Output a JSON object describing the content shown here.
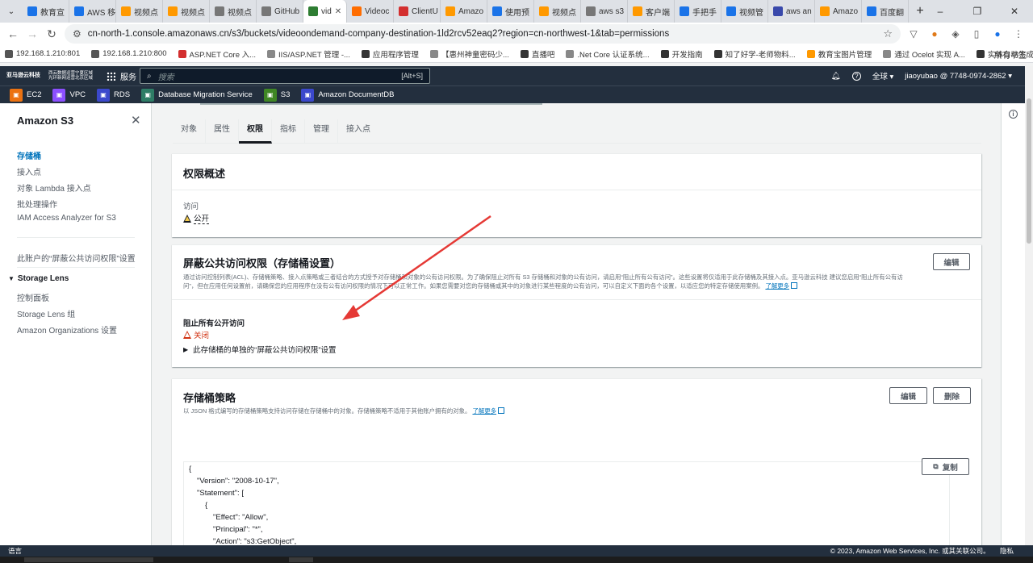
{
  "browser": {
    "tabs": [
      {
        "label": "教育宣",
        "color": "#1a73e8"
      },
      {
        "label": "AWS 移",
        "color": "#1a73e8"
      },
      {
        "label": "视频点",
        "color": "#ff9900"
      },
      {
        "label": "视频点",
        "color": "#ff9900"
      },
      {
        "label": "视频点",
        "color": "#777777"
      },
      {
        "label": "GitHub",
        "color": "#777777"
      },
      {
        "label": "vid",
        "color": "#2e7d32",
        "active": true
      },
      {
        "label": "Videoc",
        "color": "#ff6d00"
      },
      {
        "label": "ClientU",
        "color": "#d32f2f"
      },
      {
        "label": "Amazo",
        "color": "#ff9900"
      },
      {
        "label": "使用预",
        "color": "#1a73e8"
      },
      {
        "label": "视频点",
        "color": "#ff9900"
      },
      {
        "label": "aws s3",
        "color": "#777777"
      },
      {
        "label": "客户端",
        "color": "#ff9900"
      },
      {
        "label": "手把手",
        "color": "#1a73e8"
      },
      {
        "label": "视频管",
        "color": "#1a73e8"
      },
      {
        "label": "aws an",
        "color": "#3949ab"
      },
      {
        "label": "Amazo",
        "color": "#ff9900"
      },
      {
        "label": "百度翻",
        "color": "#1a73e8"
      }
    ],
    "url": "cn-north-1.console.amazonaws.cn/s3/buckets/videoondemand-company-destination-1ld2rcv52eaq2?region=cn-northwest-1&tab=permissions",
    "bookmarks": [
      {
        "label": "192.168.1.210:801",
        "color": "#555555"
      },
      {
        "label": "192.168.1.210:800",
        "color": "#555555"
      },
      {
        "label": "ASP.NET Core 入...",
        "color": "#d32f2f"
      },
      {
        "label": "IIS/ASP.NET 管理 -...",
        "color": "#888888"
      },
      {
        "label": "应用程序管理",
        "color": "#333333"
      },
      {
        "label": "【惠州神童密码少...",
        "color": "#888888"
      },
      {
        "label": "直播吧",
        "color": "#333333"
      },
      {
        "label": ".Net Core 认证系统...",
        "color": "#888888"
      },
      {
        "label": "开发指南",
        "color": "#333333"
      },
      {
        "label": "知了好学-老师物料...",
        "color": "#333333"
      },
      {
        "label": "教育宝图片管理",
        "color": "#ff9900"
      },
      {
        "label": "通过 Ocelot 实现 A...",
        "color": "#888888"
      },
      {
        "label": "实体自动生成器",
        "color": "#333333"
      }
    ],
    "all_bookmarks": "所有书签"
  },
  "aws_header": {
    "logo_text": "亚马逊云科技",
    "region_note_1": "西云数据运营宁夏区域",
    "region_note_2": "光环新网运营北京区域",
    "services_label": "服务",
    "search_placeholder": "搜索",
    "search_shortcut": "[Alt+S]",
    "region_label": "全球 ▾",
    "account_label": "jiaoyubao @ 7748-0974-2862 ▾"
  },
  "favorites": [
    {
      "label": "EC2",
      "color": "#ec7211"
    },
    {
      "label": "VPC",
      "color": "#8c4fff"
    },
    {
      "label": "RDS",
      "color": "#3b48cc"
    },
    {
      "label": "Database Migration Service",
      "color": "#2e7d66"
    },
    {
      "label": "S3",
      "color": "#3f8624"
    },
    {
      "label": "Amazon DocumentDB",
      "color": "#3b48cc"
    }
  ],
  "sidebar": {
    "title": "Amazon S3",
    "items": [
      "存储桶",
      "接入点",
      "对象 Lambda 接入点",
      "批处理操作",
      "IAM Access Analyzer for S3"
    ],
    "account_block_setting": "此账户的“屏蔽公共访问权限”设置",
    "storage_lens": "Storage Lens",
    "lens_items": [
      "控制面板",
      "Storage Lens 组",
      "Amazon Organizations 设置"
    ]
  },
  "tabs": [
    "对象",
    "属性",
    "权限",
    "指标",
    "管理",
    "接入点"
  ],
  "permissions_overview": {
    "title": "权限概述",
    "access_label": "访问",
    "access_value": "公开"
  },
  "block_public_access": {
    "title": "屏蔽公共访问权限（存储桶设置）",
    "edit": "编辑",
    "desc_1": "通过访问控制列表(ACL)、存储桶策略、接入点策略或三者结合的方式授予对存储桶和对象的公有访问权限。为了确保阻止对所有 S3 存储桶和对象的公有访问，请启用“阻止所有公有访问”。这些设置将仅适用于此存储桶及其接入点。亚马逊云科技 建议您启用“阻止所有公有访",
    "desc_2": "问”，但在应用任何设置前，请确保您的应用程序在没有公有访问权限的情况下可以正常工作。如果您需要对您的存储桶或其中的对象进行某些程度的公有访问，可以自定义下面的各个设置，以适应您的特定存储使用案例。",
    "learn_more": "了解更多",
    "block_all_label": "阻止所有公开访问",
    "block_all_value": "关闭",
    "individual_settings": "此存储桶的单独的“屏蔽公共访问权限”设置"
  },
  "bucket_policy": {
    "title": "存储桶策略",
    "edit": "编辑",
    "delete": "删除",
    "desc": "以 JSON 格式编写的存储桶策略支持访问存储在存储桶中的对象。存储桶策略不适用于其他账户拥有的对象。",
    "learn_more": "了解更多",
    "copy": "复制",
    "json_lines": [
      "{",
      "\"Version\": \"2008-10-17\",",
      "\"Statement\": [",
      "{",
      "\"Effect\": \"Allow\",",
      "\"Principal\": \"*\",",
      "\"Action\": \"s3:GetObject\","
    ]
  },
  "footer": {
    "language": "语言",
    "copyright": "© 2023, Amazon Web Services, Inc. 或其关联公司。",
    "privacy": "隐私"
  }
}
